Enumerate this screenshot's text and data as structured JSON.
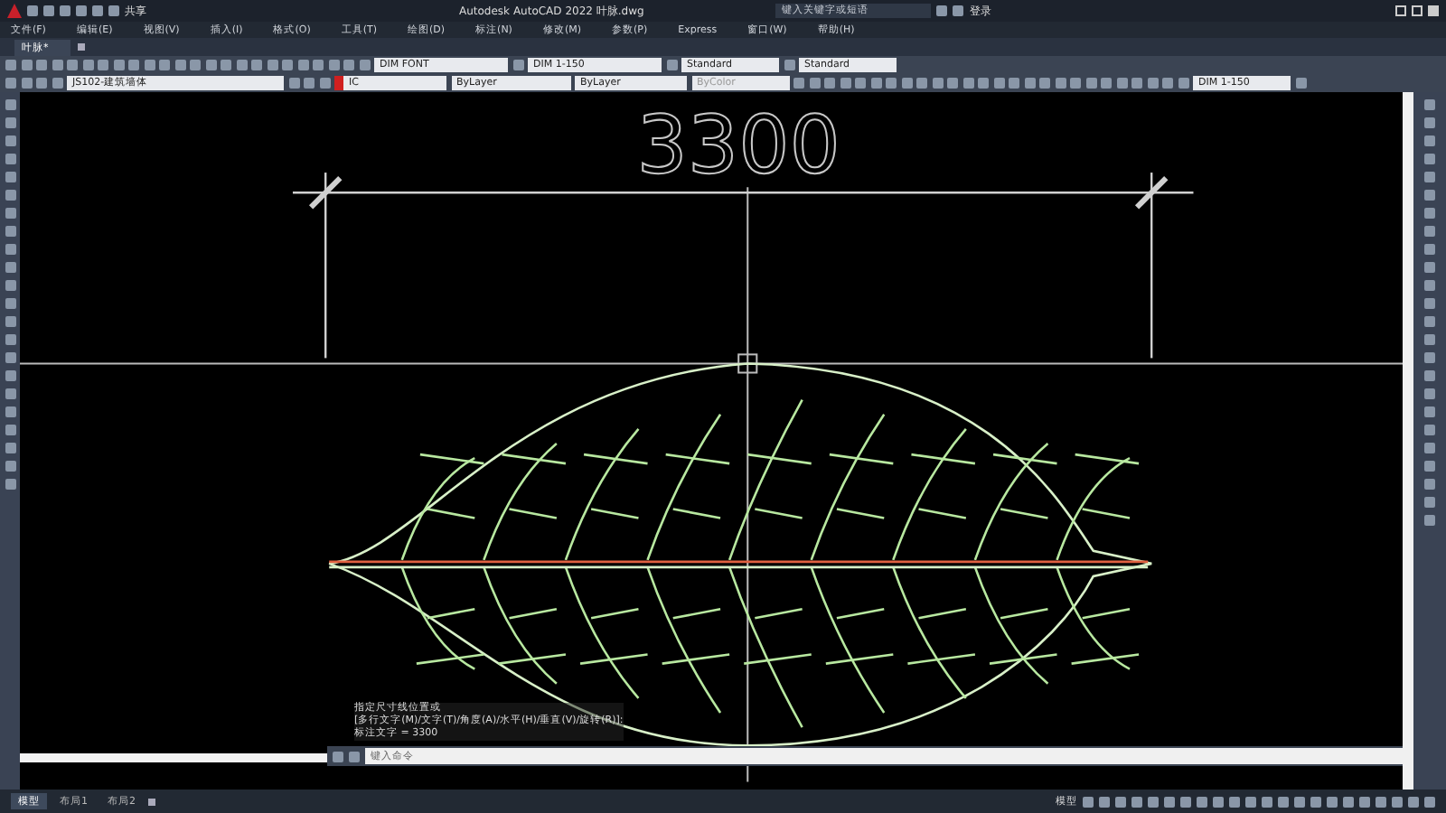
{
  "window": {
    "app_title": "Autodesk AutoCAD 2022",
    "file_name": "叶脉.dwg"
  },
  "quick_access": {
    "share": "共享"
  },
  "search": {
    "placeholder": "键入关键字或短语"
  },
  "login": "登录",
  "menu": [
    "文件(F)",
    "编辑(E)",
    "视图(V)",
    "插入(I)",
    "格式(O)",
    "工具(T)",
    "绘图(D)",
    "标注(N)",
    "修改(M)",
    "参数(P)",
    "Express",
    "窗口(W)",
    "帮助(H)"
  ],
  "doc_tabs": [
    {
      "label": "叶脉*",
      "selected": true
    }
  ],
  "styles": {
    "text_style": "DIM FONT",
    "dim_style": "DIM 1-150",
    "table_style": "Standard",
    "multileader_style": "Standard",
    "scale": "DIM 1-150"
  },
  "properties": {
    "layer": "JS102-建筑墙体",
    "color_setting": "IC",
    "linetype": "ByLayer",
    "lineweight": "ByLayer",
    "plot_style": "ByColor"
  },
  "drawing": {
    "dimension_text": "3300"
  },
  "command": {
    "history": [
      "指定尺寸线位置或",
      "[多行文字(M)/文字(T)/角度(A)/水平(H)/垂直(V)/旋转(R)]:",
      "标注文字 = 3300"
    ],
    "placeholder": "键入命令"
  },
  "layout_tabs": [
    {
      "label": "模型",
      "selected": true
    },
    {
      "label": "布局1",
      "selected": false
    },
    {
      "label": "布局2",
      "selected": false
    }
  ],
  "status": {
    "space": "模型"
  }
}
